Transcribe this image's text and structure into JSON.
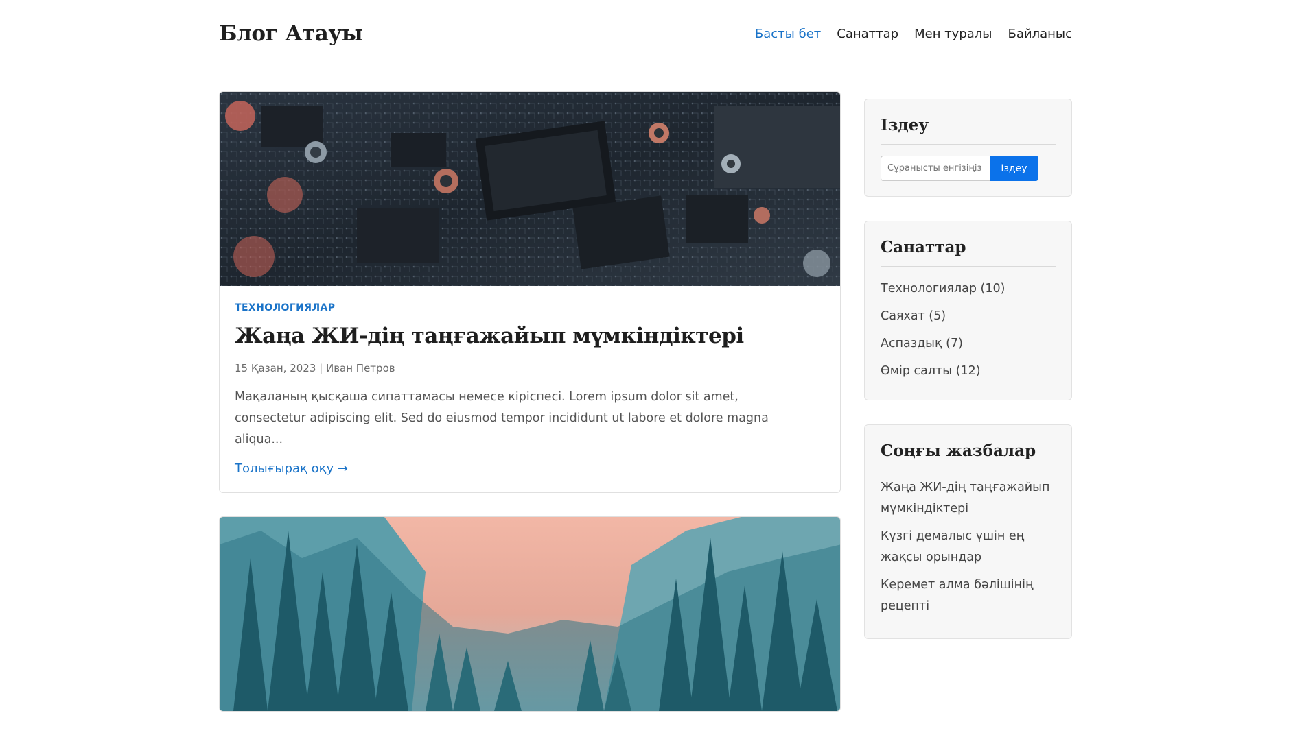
{
  "header": {
    "logo": "Блог Атауы",
    "nav": [
      {
        "label": "Басты бет",
        "active": true
      },
      {
        "label": "Санаттар",
        "active": false
      },
      {
        "label": "Мен туралы",
        "active": false
      },
      {
        "label": "Байланыс",
        "active": false
      }
    ]
  },
  "posts": [
    {
      "image_icon": "circuit-board-photo",
      "category": "Технологиялар",
      "title": "Жаңа ЖИ-дің таңғажайып мүмкіндіктері",
      "meta": "15 Қазан, 2023 | Иван Петров",
      "excerpt": "Мақаланың қысқаша сипаттамасы немесе кіріспесі. Lorem ipsum dolor sit amet, consectetur adipiscing elit. Sed do eiusmod tempor incididunt ut labore et dolore magna aliqua...",
      "read_more": "Толығырақ оқу →"
    },
    {
      "image_icon": "mountain-forest-photo"
    }
  ],
  "sidebar": {
    "search": {
      "title": "Іздеу",
      "placeholder": "Сұранысты енгізіңіз",
      "button": "Іздеу"
    },
    "categories": {
      "title": "Санаттар",
      "items": [
        "Технологиялар (10)",
        "Саяхат (5)",
        "Аспаздық (7)",
        "Өмір салты (12)"
      ]
    },
    "recent": {
      "title": "Соңғы жазбалар",
      "items": [
        "Жаңа ЖИ-дің таңғажайып мүмкіндіктері",
        "Күзгі демалыс үшін ең жақсы орындар",
        "Керемет алма бәлішінің рецепті"
      ]
    }
  },
  "colors": {
    "accent": "#1a73c8",
    "button": "#0b72ea"
  }
}
